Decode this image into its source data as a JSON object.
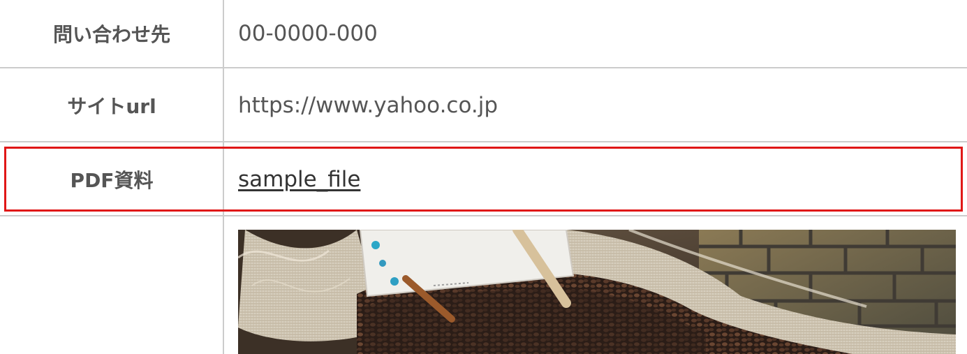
{
  "table": {
    "rows": [
      {
        "label": "問い合わせ先",
        "value": "00-0000-000"
      },
      {
        "label": "サイトurl",
        "value": "https://www.yahoo.co.jp"
      },
      {
        "label": "PDF資料",
        "link_text": "sample_file"
      }
    ]
  },
  "image": {
    "alt": "coffee beans in burlap sack photo"
  },
  "colors": {
    "border": "#cccccc",
    "highlight": "#e01717",
    "text": "#555555",
    "link": "#333333"
  }
}
